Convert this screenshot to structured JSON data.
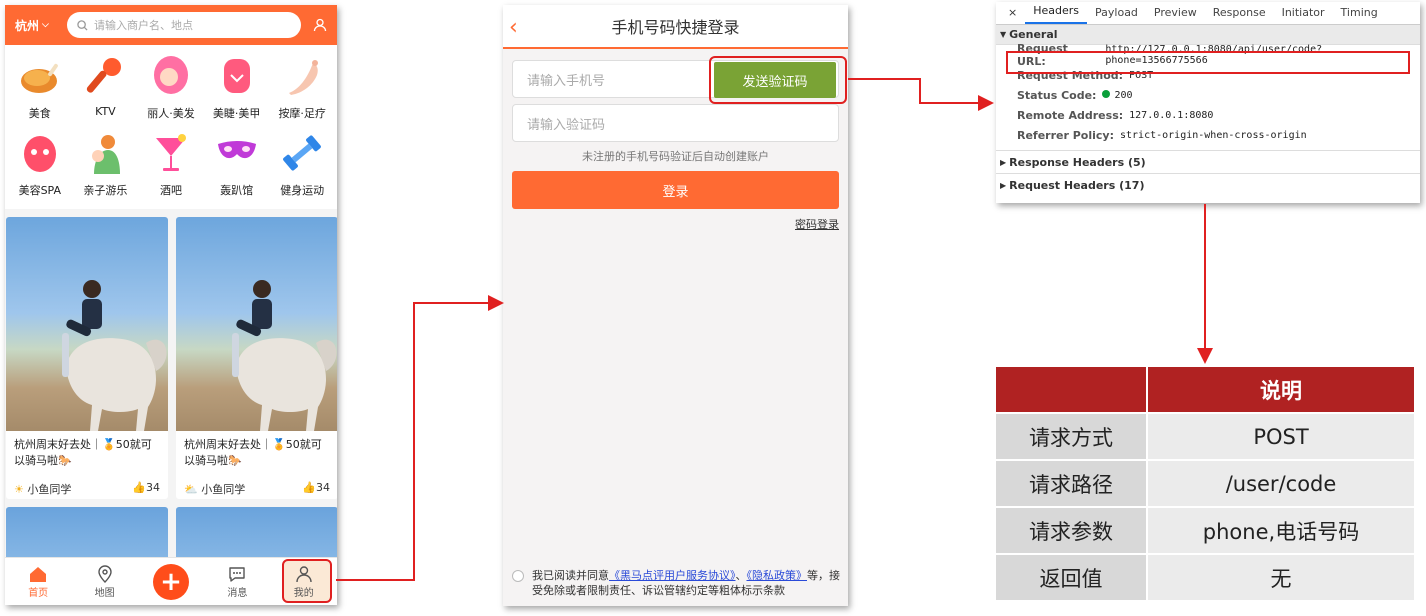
{
  "phone1": {
    "city": "杭州",
    "search_placeholder": "请输入商户名、地点",
    "categories": [
      {
        "label": "美食",
        "icon": "roast-chicken-icon"
      },
      {
        "label": "KTV",
        "icon": "microphone-icon"
      },
      {
        "label": "丽人·美发",
        "icon": "woman-hair-icon"
      },
      {
        "label": "美睫·美甲",
        "icon": "nail-icon"
      },
      {
        "label": "按摩·足疗",
        "icon": "foot-massage-icon"
      },
      {
        "label": "美容SPA",
        "icon": "face-mask-icon"
      },
      {
        "label": "亲子游乐",
        "icon": "family-icon"
      },
      {
        "label": "酒吧",
        "icon": "cocktail-icon"
      },
      {
        "label": "轰趴馆",
        "icon": "party-mask-icon"
      },
      {
        "label": "健身运动",
        "icon": "dumbbell-icon"
      }
    ],
    "cards": [
      {
        "title": "杭州周末好去处｜🏅50就可以骑马啦🐎",
        "author": "小鱼同学",
        "likes": "34"
      },
      {
        "title": "杭州周末好去处｜🏅50就可以骑马啦🐎",
        "author": "小鱼同学",
        "likes": "34"
      }
    ],
    "tabs": [
      {
        "label": "首页",
        "icon": "home-icon"
      },
      {
        "label": "地图",
        "icon": "map-pin-icon"
      },
      {
        "label": "",
        "icon": "plus-icon"
      },
      {
        "label": "消息",
        "icon": "message-icon"
      },
      {
        "label": "我的",
        "icon": "user-icon"
      }
    ]
  },
  "phone2": {
    "title": "手机号码快捷登录",
    "phone_placeholder": "请输入手机号",
    "send_code": "发送验证码",
    "code_placeholder": "请输入验证码",
    "hint": "未注册的手机号码验证后自动创建账户",
    "login": "登录",
    "password_login": "密码登录",
    "agree_pre": "我已阅读并同意",
    "agree_link1": "《黑马点评用户服务协议》",
    "agree_sep": "、",
    "agree_link2": "《隐私政策》",
    "agree_post": "等，接受免除或者限制责任、诉讼管辖约定等粗体标示条款"
  },
  "devtools": {
    "tabs": [
      "Headers",
      "Payload",
      "Preview",
      "Response",
      "Initiator",
      "Timing"
    ],
    "general": "General",
    "request_url_label": "Request URL:",
    "request_url": "http://127.0.0.1:8080/api/user/code?phone=13566775566",
    "method_label": "Request Method:",
    "method": "POST",
    "status_label": "Status Code:",
    "status": "200",
    "remote_label": "Remote Address:",
    "remote": "127.0.0.1:8080",
    "referrer_label": "Referrer Policy:",
    "referrer": "strict-origin-when-cross-origin",
    "response_headers": "Response Headers (5)",
    "request_headers": "Request Headers (17)"
  },
  "table": {
    "header": [
      "",
      "说明"
    ],
    "rows": [
      [
        "请求方式",
        "POST"
      ],
      [
        "请求路径",
        "/user/code"
      ],
      [
        "请求参数",
        "phone,电话号码"
      ],
      [
        "返回值",
        "无"
      ]
    ]
  },
  "colors": {
    "accent": "#ff6a33",
    "send_button": "#7aa335",
    "highlight": "#e02020",
    "table_header": "#b02222"
  }
}
